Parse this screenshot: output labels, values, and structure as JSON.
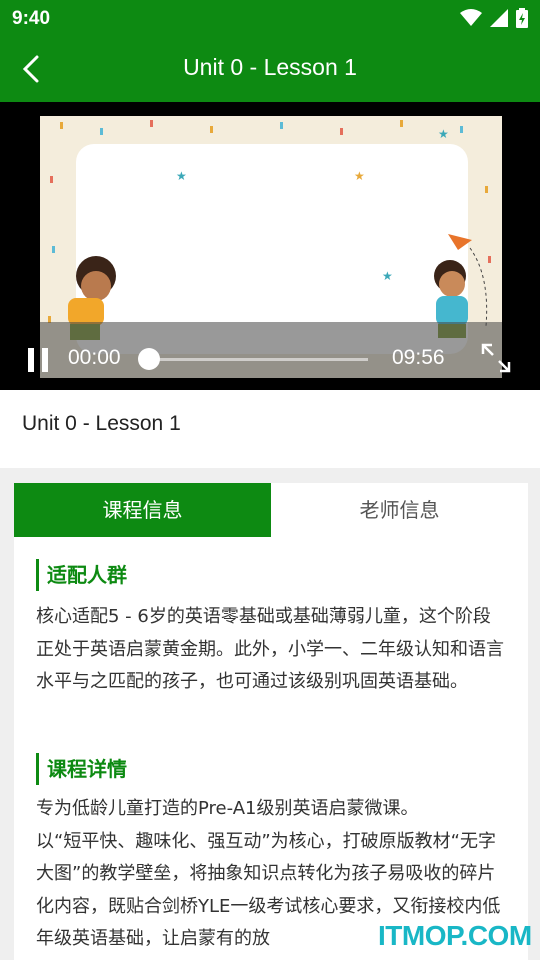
{
  "status_bar": {
    "time": "9:40"
  },
  "appbar": {
    "title": "Unit 0 - Lesson 1"
  },
  "player": {
    "current_time": "00:00",
    "duration": "09:56",
    "progress": 0
  },
  "lesson": {
    "title": "Unit 0 - Lesson 1"
  },
  "tabs": [
    {
      "label": "课程信息",
      "active": true
    },
    {
      "label": "老师信息",
      "active": false
    }
  ],
  "sections": [
    {
      "heading": "适配人群",
      "body": "核心适配5 - 6岁的英语零基础或基础薄弱儿童，这个阶段正处于英语启蒙黄金期。此外，小学一、二年级认知和语言水平与之匹配的孩子，也可通过该级别巩固英语基础。"
    },
    {
      "heading": "课程详情",
      "body": "专为低龄儿童打造的Pre-A1级别英语启蒙微课。\n以“短平快、趣味化、强互动”为核心，打破原版教材“无字大图”的教学壁垒，将抽象知识点转化为孩子易吸收的碎片化内容，既贴合剑桥YLE一级考试核心要求，又衔接校内低年级英语基础，让启蒙有的放"
    }
  ],
  "watermark": "ITMOP.COM",
  "colors": {
    "primary": "#0d8a12",
    "watermark": "#19b7c6"
  }
}
